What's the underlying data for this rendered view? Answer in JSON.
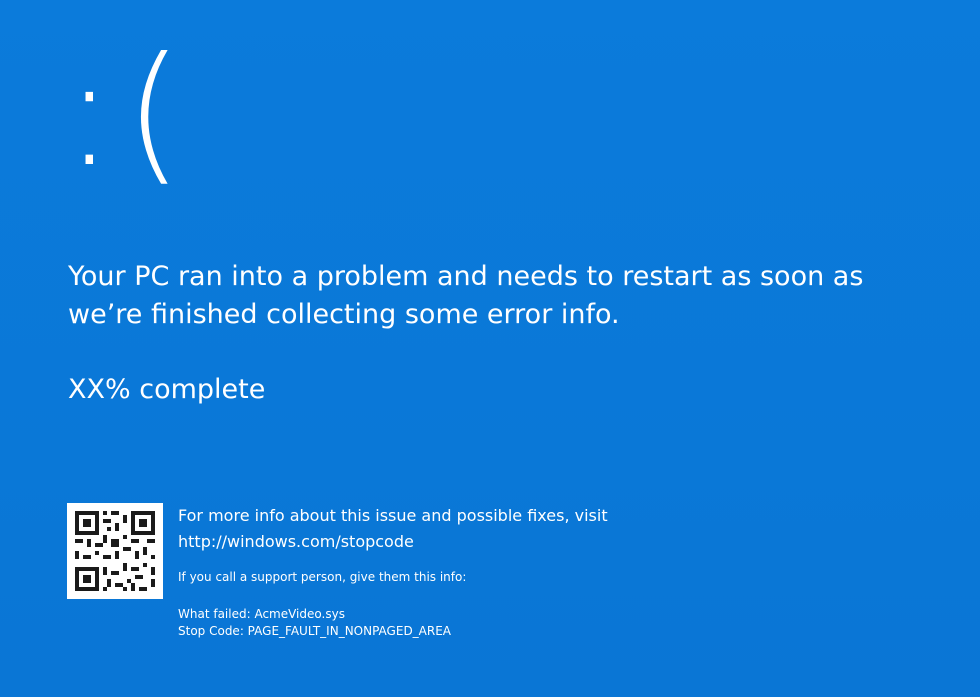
{
  "face": ":(",
  "message": "Your PC ran into a problem and needs to restart as soon as we’re finished collecting some error info.",
  "progress": "XX% complete",
  "qr": {
    "icon": "qr-code-icon"
  },
  "info": {
    "more_info": "For more info about this issue and possible fixes, visit",
    "url": "http://windows.com/stopcode",
    "support_hint": "If you call a support person, give them this info:",
    "what_failed": "What failed: AcmeVideo.sys",
    "stop_code": "Stop Code: PAGE_FAULT_IN_NONPAGED_AREA"
  },
  "colors": {
    "background": "#0a78d7",
    "text": "#ffffff"
  }
}
